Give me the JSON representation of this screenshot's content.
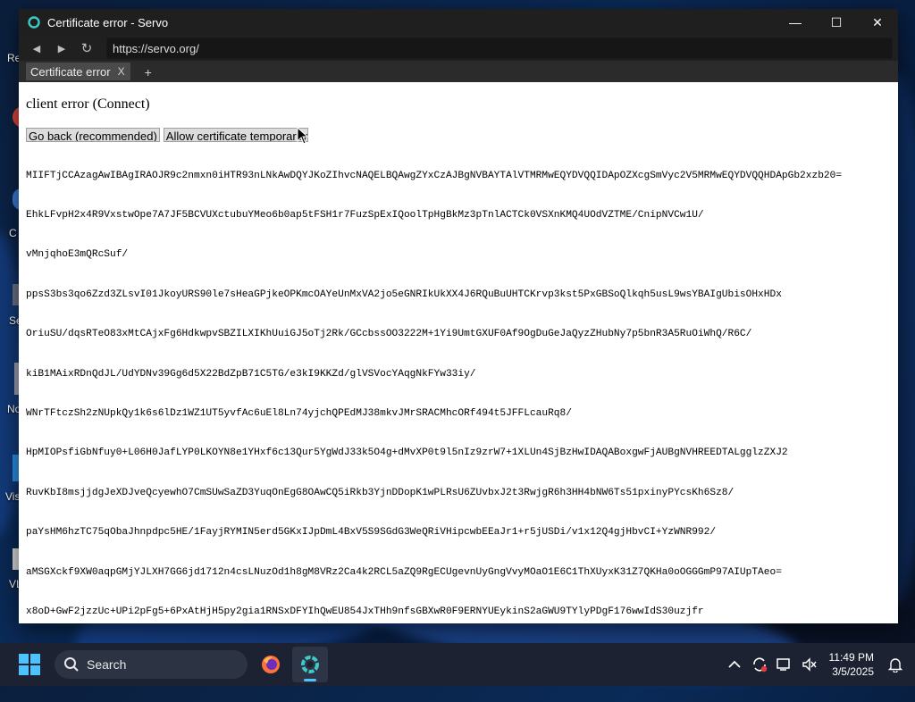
{
  "desktop": {
    "labels": [
      "Re",
      "C",
      "Se",
      "No",
      "Vis",
      "VL"
    ]
  },
  "window": {
    "title": "Certificate error - Servo",
    "controls": {
      "minimize": "—",
      "maximize": "☐",
      "close": "✕"
    }
  },
  "nav": {
    "back": "◀",
    "forward": "▶",
    "reload": "↻",
    "url": "https://servo.org/"
  },
  "tabs": [
    {
      "label": "Certificate error",
      "close": "X"
    }
  ],
  "new_tab": "+",
  "page": {
    "heading": "client error (Connect)",
    "go_back_button": "Go back (recommended)",
    "allow_button": "Allow certificate temporarily",
    "certificate_lines": [
      "MIIFTjCCAzagAwIBAgIRAOJR9c2nmxn0iHTR93nLNkAwDQYJKoZIhvcNAQELBQAwgZYxCzAJBgNVBAYTAlVTMRMwEQYDVQQIDApOZXcgSmVyc2V5MRMwEQYDVQQHDApGb2xzb20=",
      "EhkLFvpH2x4R9VxstwOpe7A7JF5BCVUXctubuYMeo6b0ap5tFSH1r7FuzSpExIQoolTpHgBkMz3pTnlACTCk0VSXnKMQ4UOdVZTME/CnipNVCw1U/",
      "vMnjqhoE3mQRcSuf/",
      "ppsS3bs3qo6Zzd3ZLsvI01JkoyURS90le7sHeaGPjkeOPKmcOAYeUnMxVA2jo5eGNRIkUkXX4J6RQuBuUHTCKrvp3kst5PxGBSoQlkqh5usL9wsYBAIgUbisOHxHDx",
      "OriuSU/dqsRTeO83xMtCAjxFg6HdkwpvSBZILXIKhUuiGJ5oTj2Rk/GCcbssOO3222M+1Yi9UmtGXUF0Af9OgDuGeJaQyzZHubNy7p5bnR3A5RuOiWhQ/R6C/",
      "kiB1MAixRDnQdJL/UdYDNv39Gg6d5X22BdZpB71C5TG/e3kI9KKZd/glVSVocYAqgNkFYw33iy/",
      "WNrTFtczSh2zNUpkQy1k6s6lDz1WZ1UT5yvfAc6uEl8Ln74yjchQPEdMJ38mkvJMrSRACMhcORf494t5JFFLcauRq8/",
      "HpMIOPsfiGbNfuy0+L06H0JafLYP0LKOYN8e1YHxf6c13Qur5YgWdJ33k5O4g+dMvXP0t9l5nIz9zrW7+1XLUn4SjBzHwIDAQABoxgwFjAUBgNVHREEDTALgglzZXJ2",
      "RuvKbI8msjjdgJeXDJveQcyewhO7CmSUwSaZD3YuqOnEgG8OAwCQ5iRkb3YjnDDopK1wPLRsU6ZUvbxJ2t3RwjgR6h3HH4bNW6Ts51pxinyPYcsKh6Sz8/",
      "paYsHM6hzTC75qObaJhnpdpc5HE/1FayjRYMIN5erd5GKxIJpDmL4BxV5S9SGdG3WeQRiVHipcwbEEaJr1+r5jUSDi/v1x12Q4gjHbvCI+YzWNR992/",
      "aMSGXckf9XW0aqpGMjYJLXH7GG6jd1712n4csLNuzOd1h8gM8VRz2Ca4k2RCL5aZQ9RgECUgevnUyGngVvyMOaO1E6C1ThXUyxK31Z7QKHa0oOGGGmP97AIUpTAeo=",
      "x8oD+GwF2jzzUc+UPi2pFg5+6PxAtHjH5py2gia1RNSxDFYIhQwEU854JxTHh9nfsGBXwR0F9ERNYUEykinS2aGWU9TYlyPDgF176wwIdS30uzjfr"
    ]
  },
  "taskbar": {
    "search_label": "Search",
    "time": "11:49 PM",
    "date": "3/5/2025",
    "accent": "#4cc2ff"
  }
}
